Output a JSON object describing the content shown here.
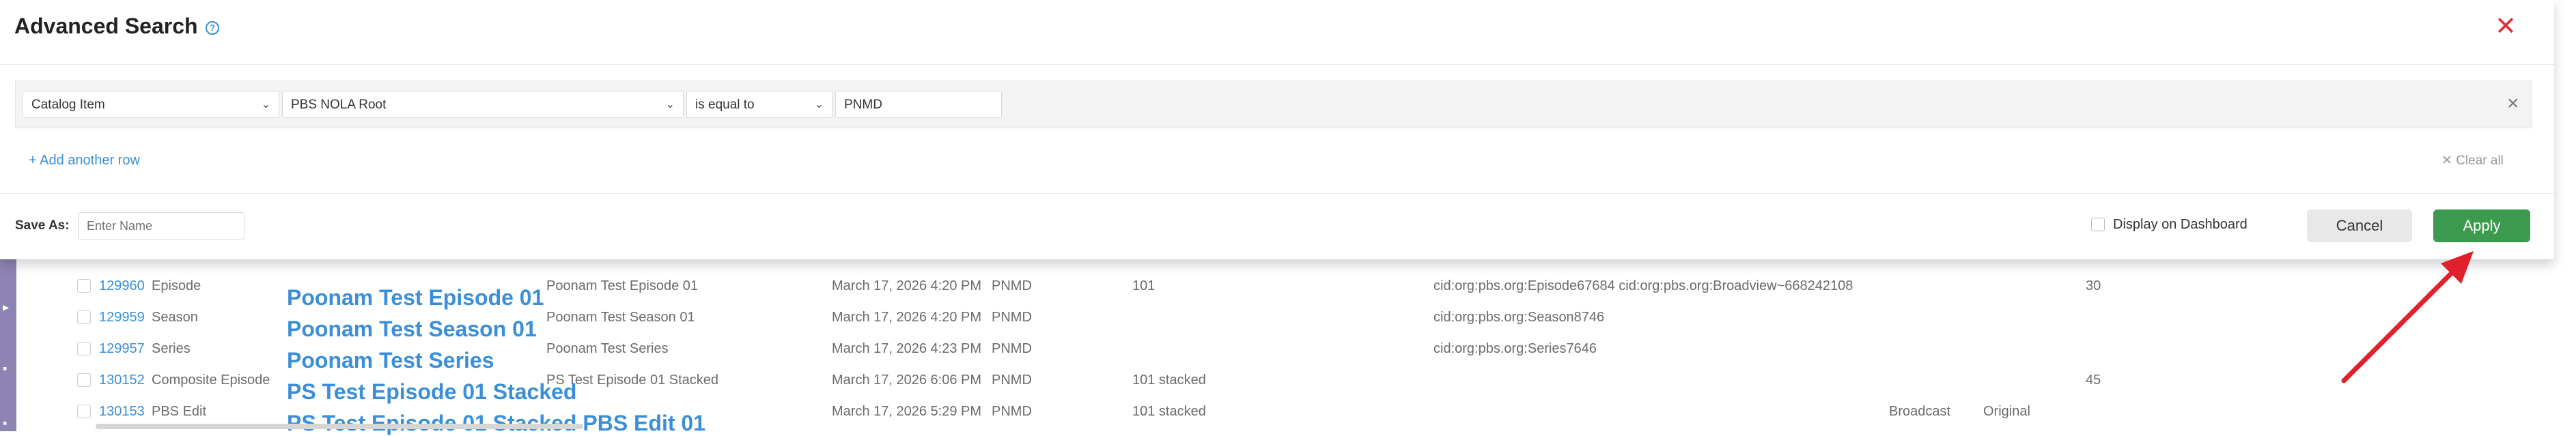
{
  "modal": {
    "title": "Advanced Search",
    "help_icon": "?",
    "close_icon": "✕",
    "filter": {
      "field": "Catalog Item",
      "scope": "PBS NOLA Root",
      "operator": "is equal to",
      "value": "PNMD"
    },
    "add_row_label": "+ Add another row",
    "clear_all_label": "✕  Clear all",
    "save_as_label": "Save As:",
    "save_as_placeholder": "Enter Name",
    "display_dashboard_label": "Display on Dashboard",
    "cancel_label": "Cancel",
    "apply_label": "Apply"
  },
  "table": {
    "rows": [
      {
        "id": "129960",
        "type": "Episode",
        "title": "Poonam Test Episode 01",
        "name": "Poonam Test Episode 01",
        "date": "March 17, 2026 4:20 PM",
        "source": "PNMD",
        "num": "101",
        "cid": "cid:org:pbs.org:Episode67684  cid:org:pbs.org:Broadview~668242108",
        "n2": "30",
        "bc": "",
        "orig": ""
      },
      {
        "id": "129959",
        "type": "Season",
        "title": "Poonam Test Season 01",
        "name": "Poonam Test Season 01",
        "date": "March 17, 2026 4:20 PM",
        "source": "PNMD",
        "num": "",
        "cid": "cid:org:pbs.org:Season8746",
        "n2": "",
        "bc": "",
        "orig": ""
      },
      {
        "id": "129957",
        "type": "Series",
        "title": "Poonam Test Series",
        "name": "Poonam Test Series",
        "date": "March 17, 2026 4:23 PM",
        "source": "PNMD",
        "num": "",
        "cid": "cid:org:pbs.org:Series7646",
        "n2": "",
        "bc": "",
        "orig": ""
      },
      {
        "id": "130152",
        "type": "Composite Episode",
        "title": "PS Test Episode 01 Stacked",
        "name": "PS Test Episode 01 Stacked",
        "date": "March 17, 2026 6:06 PM",
        "source": "PNMD",
        "num": "101 stacked",
        "cid": "",
        "n2": "45",
        "bc": "",
        "orig": ""
      },
      {
        "id": "130153",
        "type": "PBS Edit",
        "title": "PS Test Episode 01 Stacked PBS Edit 01",
        "name": "",
        "date": "March 17, 2026 5:29 PM",
        "source": "PNMD",
        "num": "101 stacked",
        "cid": "",
        "n2": "",
        "bc": "Broadcast",
        "orig": "Original"
      }
    ]
  },
  "colors": {
    "accent": "#3a8fd8",
    "apply": "#3c9a4f",
    "close": "#e0303a",
    "arrow": "#e0202a",
    "sidebar": "#8e84b3"
  }
}
